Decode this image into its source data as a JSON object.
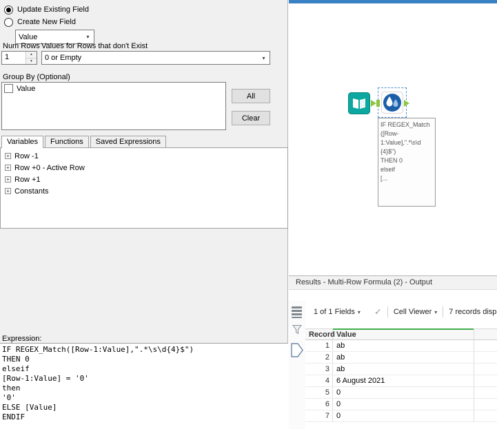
{
  "config": {
    "radios": {
      "update_existing": "Update Existing Field",
      "create_new": "Create New Field"
    },
    "field_select": {
      "value": "Value"
    },
    "num_rows": {
      "label": "Num Rows",
      "value": "1"
    },
    "missing_values": {
      "label": "Values for Rows that don't Exist",
      "value": "0 or Empty"
    },
    "group_by": {
      "label": "Group By (Optional)",
      "items": [
        {
          "label": "Value"
        }
      ],
      "all_button": "All",
      "clear_button": "Clear"
    },
    "tabs": {
      "variables": "Variables",
      "functions": "Functions",
      "saved": "Saved Expressions"
    },
    "tree": {
      "items": [
        {
          "label": "Row -1"
        },
        {
          "label": "Row +0 - Active Row"
        },
        {
          "label": "Row +1"
        },
        {
          "label": "Constants"
        }
      ]
    },
    "expression": {
      "label": "Expression:",
      "code": "IF REGEX_Match([Row-1:Value],\".*\\s\\d{4}$\")\nTHEN 0\nelseif\n[Row-1:Value] = '0'\nthen\n'0'\nELSE [Value]\nENDIF"
    }
  },
  "canvas": {
    "annotation_lines": [
      "IF REGEX_Match",
      "([Row-",
      "1:Value],\".*\\s\\d",
      "{4}$\")",
      "THEN 0",
      "elseif",
      "[..."
    ]
  },
  "results": {
    "title": "Results - Multi-Row Formula (2) - Output",
    "toolbar": {
      "fields": "1 of 1 Fields",
      "cell_viewer": "Cell Viewer",
      "records": "7 records disp"
    },
    "table": {
      "columns": {
        "record": "Record",
        "value": "Value"
      },
      "rows": [
        {
          "record": "1",
          "value": "ab"
        },
        {
          "record": "2",
          "value": "ab"
        },
        {
          "record": "3",
          "value": "ab"
        },
        {
          "record": "4",
          "value": "6 August 2021"
        },
        {
          "record": "5",
          "value": "0"
        },
        {
          "record": "6",
          "value": "0"
        },
        {
          "record": "7",
          "value": "0"
        }
      ]
    }
  },
  "icons": {
    "caret": "▾",
    "check": "✓",
    "plus": "+",
    "spin_up": "▲",
    "spin_down": "▼"
  }
}
